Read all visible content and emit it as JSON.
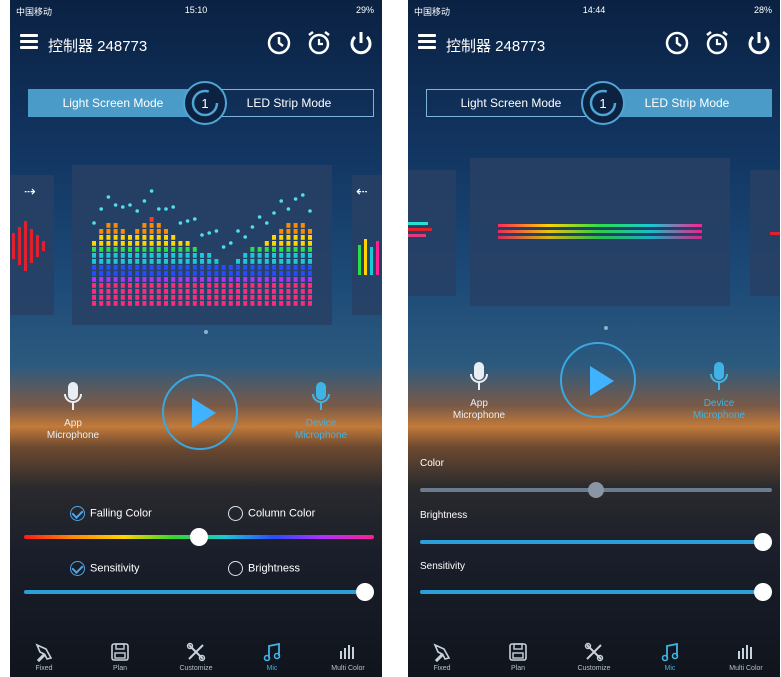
{
  "left": {
    "status": {
      "carrier": "中国移动",
      "time": "15:10",
      "battery": "29%"
    },
    "header": {
      "device_name": "控制器 248773"
    },
    "mode": {
      "light_screen": "Light Screen Mode",
      "led_strip": "LED Strip Mode",
      "active": "light_screen"
    },
    "mics": {
      "app_line1": "App",
      "app_line2": "Microphone",
      "device_line1": "Device",
      "device_line2": "Microphone"
    },
    "options": {
      "falling_color": "Falling Color",
      "column_color": "Column Color",
      "sensitivity": "Sensitivity",
      "brightness": "Brightness"
    },
    "sliders": {
      "color_value": 0.5,
      "sensitivity_value": 1.0
    }
  },
  "right": {
    "status": {
      "carrier": "中国移动",
      "time": "14:44",
      "battery": "28%"
    },
    "header": {
      "device_name": "控制器 248773"
    },
    "mode": {
      "light_screen": "Light Screen Mode",
      "led_strip": "LED Strip Mode",
      "active": "led_strip"
    },
    "mics": {
      "app_line1": "App",
      "app_line2": "Microphone",
      "device_line1": "Device",
      "device_line2": "Microphone"
    },
    "labels": {
      "color": "Color",
      "brightness": "Brightness",
      "sensitivity": "Sensitivity"
    },
    "sliders": {
      "color_value": 0.5,
      "brightness_value": 1.0,
      "sensitivity_value": 1.0
    }
  },
  "tabs": [
    {
      "label": "Fixed",
      "icon": "pin-icon"
    },
    {
      "label": "Plan",
      "icon": "save-icon"
    },
    {
      "label": "Customize",
      "icon": "tools-icon"
    },
    {
      "label": "Mic",
      "icon": "music-note-icon",
      "active": true
    },
    {
      "label": "Multi Color",
      "icon": "bars-icon"
    }
  ],
  "colors": {
    "accent": "#3fb3e6",
    "active_mode": "#4a9bc8"
  }
}
